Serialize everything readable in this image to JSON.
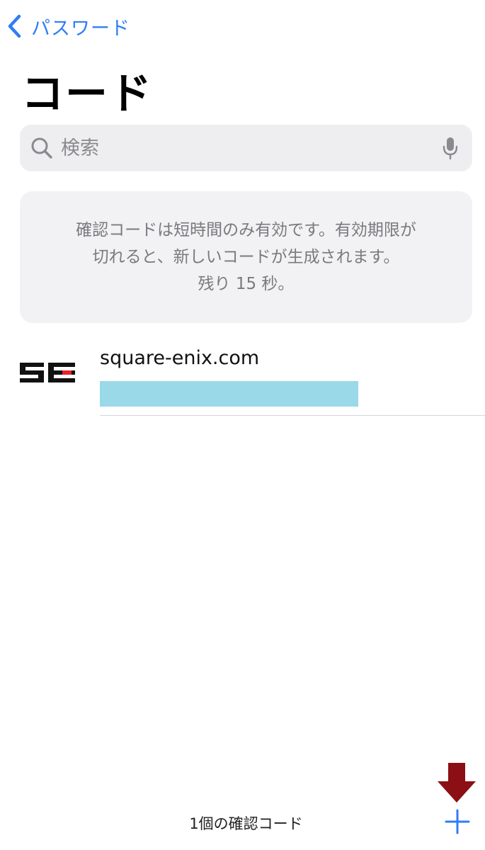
{
  "nav": {
    "back_label": "パスワード",
    "back_icon": "chevron-left-icon",
    "accent": "#2f7df6"
  },
  "page": {
    "title": "コード"
  },
  "search": {
    "placeholder": "検索",
    "value": "",
    "icons": [
      "search-icon",
      "mic-icon"
    ]
  },
  "info": {
    "text": "確認コードは短時間のみ有効です。有効期限が\n切れると、新しいコードが生成されます。\n残り 15 秒。"
  },
  "codes": [
    {
      "site": "square-enix.com",
      "logo": "SE",
      "code_redaction_color": "#99d9e8"
    }
  ],
  "toolbar": {
    "count_label": "1個の確認コード",
    "add_icon": "plus-icon",
    "annotation_icon": "arrow-down-icon",
    "annotation_color": "#8b0f14"
  }
}
